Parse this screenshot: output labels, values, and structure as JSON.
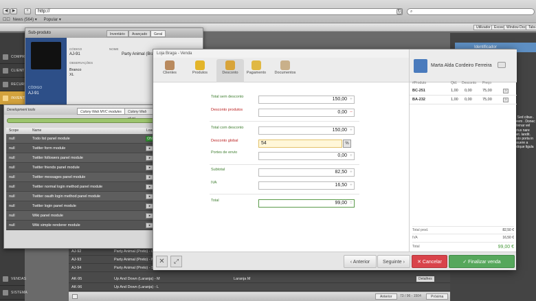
{
  "browser": {
    "url": "http://",
    "bookmarks": [
      "News (564) ▾",
      "Popular ▾"
    ]
  },
  "app": {
    "top_buttons": [
      "Utilizador",
      "Exceel",
      "Window Dock",
      "Tabs"
    ],
    "nav": [
      "COMPR",
      "CLIENT",
      "RECURS",
      "INVENT",
      "VENDAS",
      "SISTEMA"
    ],
    "identify": "Identificador"
  },
  "subproduct": {
    "title": "Sub-produto",
    "tabs": [
      "Inventário",
      "Avançado",
      "Geral"
    ],
    "code_label": "CÓDIGO",
    "code": "AJ-91",
    "name_label": "NOME",
    "name": "Party Animal (Branco) - XL",
    "obs_label": "OBSERVAÇÕES",
    "obs": "Branco",
    "obs2": "XL",
    "left_code_label": "CÓDIGO",
    "left_code": "AJ-91"
  },
  "devtools": {
    "title": "Development tools",
    "tabs": [
      "Colony Web MVC modules",
      "Colony Web plugi"
    ],
    "columns": [
      "Scope",
      "Name",
      "Load"
    ],
    "rows": [
      {
        "scope": "null",
        "name": "Todo list panel module",
        "btn": "ON"
      },
      {
        "scope": "null",
        "name": "Twitter form module",
        "btn": "▸"
      },
      {
        "scope": "null",
        "name": "Twitter followers panel module",
        "btn": "▸"
      },
      {
        "scope": "null",
        "name": "Twitter friends panel module",
        "btn": "▸"
      },
      {
        "scope": "null",
        "name": "Twitter messages panel module",
        "btn": "▸"
      },
      {
        "scope": "null",
        "name": "Twitter normal login method panel module",
        "btn": "▸"
      },
      {
        "scope": "null",
        "name": "Twitter oauth login method panel module",
        "btn": "▸"
      },
      {
        "scope": "null",
        "name": "Twitter login panel module",
        "btn": "▸"
      },
      {
        "scope": "null",
        "name": "Wiki panel module",
        "btn": "▸"
      },
      {
        "scope": "null",
        "name": "Wiki simple renderer module",
        "btn": "▸"
      }
    ]
  },
  "bgtable": {
    "rows": [
      {
        "code": "AJ-92",
        "name": "Party Animal (Preto) - L",
        "detail": ""
      },
      {
        "code": "AJ-93",
        "name": "Party Animal (Preto) - M",
        "detail": ""
      },
      {
        "code": "AJ-94",
        "name": "Party Animal (Preto) - S",
        "detail": ""
      },
      {
        "code": "AK-95",
        "name": "Up And Down (Laranja) - M",
        "detail": "Laranja M"
      },
      {
        "code": "AK-96",
        "name": "Up And Down (Laranja) - L",
        "detail": ""
      }
    ],
    "details": "Detalhes",
    "prev": "Anterior",
    "range": "73 / 96 - 1504",
    "next": "Próxima"
  },
  "modal": {
    "title": "Loja Braga - Venda",
    "steps": [
      "Clientes",
      "Produtos",
      "Desconto",
      "Pagamento",
      "Documentos"
    ],
    "fields": {
      "total_sem_desconto": {
        "label": "Total sem desconto",
        "value": "150,00"
      },
      "desconto_produtos": {
        "label": "Desconto produtos",
        "value": "0,00"
      },
      "total_com_desconto": {
        "label": "Total com desconto",
        "value": "150,00"
      },
      "desconto_global": {
        "label": "Desconto global",
        "value": "54"
      },
      "portes_envio": {
        "label": "Portes de envio",
        "value": "0,00"
      },
      "subtotal": {
        "label": "Subtotal",
        "value": "82,50"
      },
      "iva": {
        "label": "IVA",
        "value": "16,50"
      },
      "total": {
        "label": "Total",
        "value": "99,00"
      }
    },
    "pct_symbol": "%",
    "prev": "Anterior",
    "next": "Seguinte",
    "cancel": "Cancelar",
    "finish": "Finalizar venda"
  },
  "client": {
    "name": "Marta Alda Cordeiro Ferreira",
    "columns": [
      "#Produto",
      "Qtd.",
      "Desconto",
      "Preço"
    ],
    "items": [
      {
        "code": "BC-251",
        "qty": "1,00",
        "disc": "0,00",
        "price": "75,00"
      },
      {
        "code": "BA-232",
        "qty": "1,00",
        "disc": "0,00",
        "price": "75,00"
      }
    ],
    "totals": {
      "prod_label": "Total prod.",
      "prod": "82,50 €",
      "iva_label": "IVA",
      "iva": "16,50 €",
      "total_label": "Total",
      "total": "99,00 €"
    }
  },
  "side_text": "st. Sed cibus . Lorem . Donec pulvinar vel varius nare eget. landit. Justo porta in posuere a tristique ligula"
}
